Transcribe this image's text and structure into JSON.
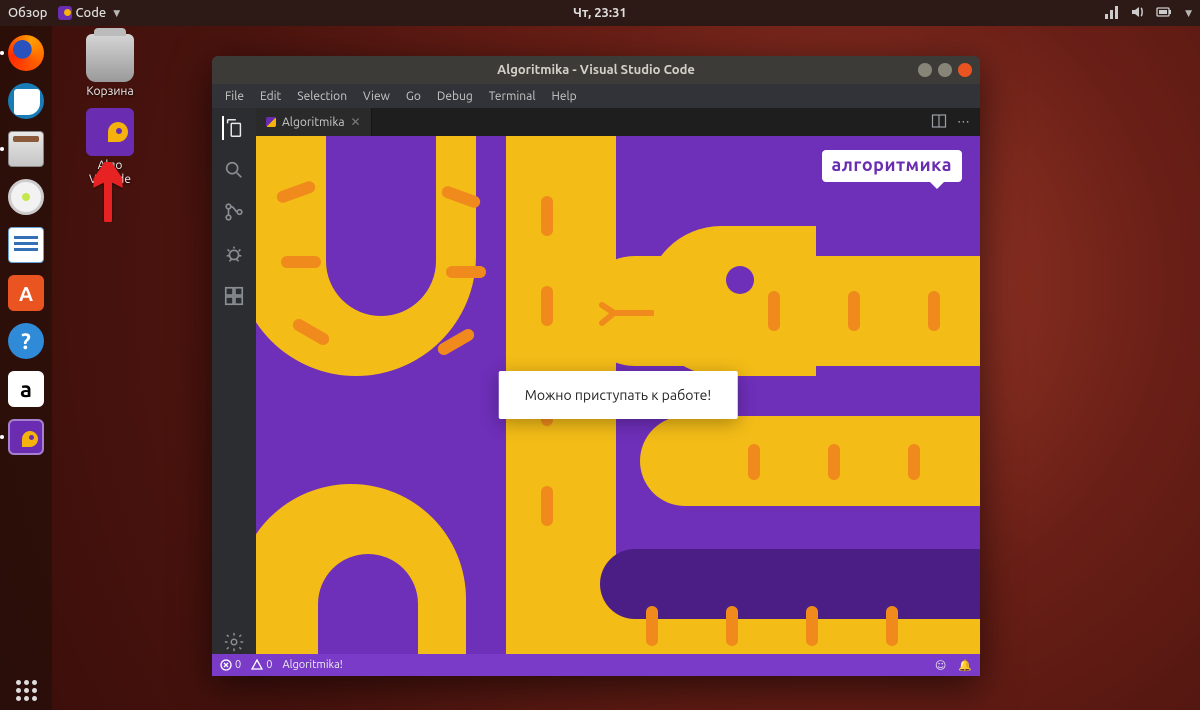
{
  "panel": {
    "overview": "Обзор",
    "app_menu": "Code",
    "datetime": "Чт, 23:31"
  },
  "desktop": {
    "trash": "Корзина",
    "algo": "Algo\nVSCode"
  },
  "window": {
    "title": "Algoritmika - Visual Studio Code",
    "menu": [
      "File",
      "Edit",
      "Selection",
      "View",
      "Go",
      "Debug",
      "Terminal",
      "Help"
    ],
    "tab": "Algoritmika",
    "logo": "алгоритмика",
    "message": "Можно приступать к работе!",
    "status": {
      "errors": "0",
      "warnings": "0",
      "ext": "Algoritmika!"
    }
  }
}
